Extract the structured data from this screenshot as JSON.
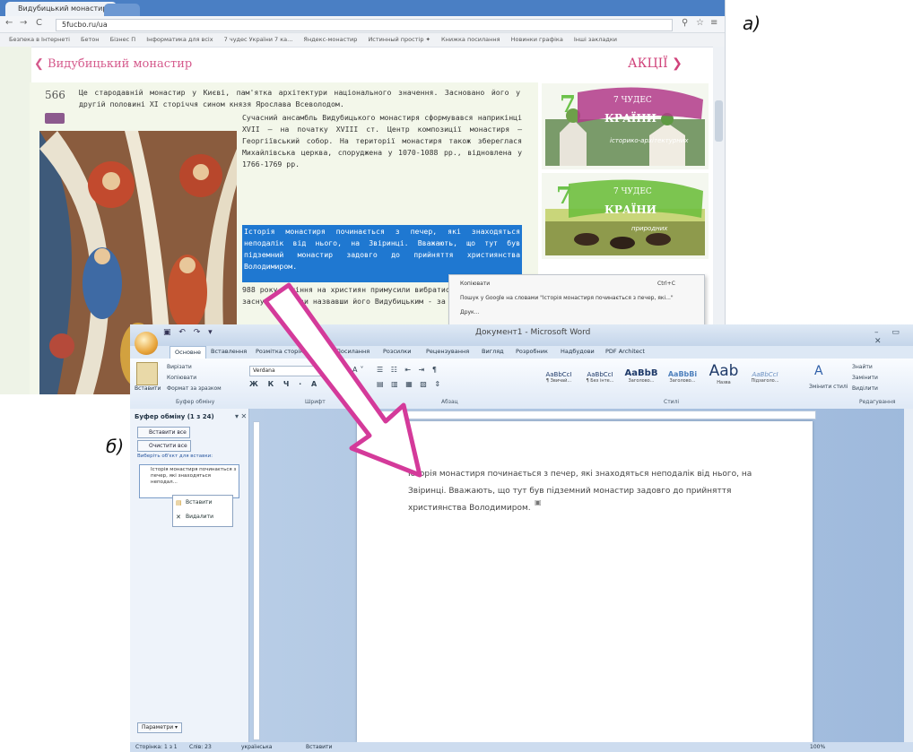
{
  "labels": {
    "a": "а)",
    "b": "б)"
  },
  "browser": {
    "tab_title": "Видубицький монастир",
    "url": "5fucbo.ru/ua",
    "window_controls": "— ▭ ✕",
    "bookmarks": [
      "Безпека в Інтернеті",
      "Бетон",
      "Бізнес П",
      "Інформатика для всіх",
      "7 чудес України 7 ка...",
      "Яндекс-монастир",
      "Истинный простір ✦",
      "Книжка посилання",
      "Новинки графіка",
      "Інші закладки"
    ],
    "site_title": "Видубицький монастир",
    "promo_label": "АКЦІЇ",
    "page_number": "566",
    "article_intro": "Це стародавній монастир у Києві, пам'ятка архітектури національного значення. Засновано його у другій половині XI сторіччя сином князя Ярослава Всеволодом.",
    "article_p1": "Сучасний ансамбль Видубицького монастиря сформувався наприкінці XVII – на початку XVIII ст. Центр композиції монастиря — Георгіївський собор. На території монастиря також збереглася Михайлівська церква, споруджена у 1070-1088 рр., відновлена у 1766-1769 рр.",
    "article_selected": "Історія монастиря починається з печер, які знаходяться неподалік від нього, на Звіринці. Вважають, що тут був підземний монастир задовго до прийняття християнства Володимиром.",
    "article_after": "988 року гоніння на християн примусили вибратися з підлля, заснувавши нови назвавши його Видубицьким - за назво",
    "context_menu": {
      "copy": "Копіювати",
      "copy_shortcut": "Ctrl+C",
      "search": "Пошук у Google на словами \"Історія монастиря починається з печер, які...\"",
      "more": "Друк..."
    },
    "ads": [
      {
        "line1": "7 ЧУДЕС",
        "line2": "КРАЇНИ",
        "line3": "історико-архітектурних"
      },
      {
        "line1": "7 ЧУДЕС",
        "line2": "КРАЇНИ",
        "line3": "природних"
      }
    ]
  },
  "word": {
    "window_title": "Документ1 - Microsoft Word",
    "tabs": [
      "Основне",
      "Вставлення",
      "Розмітка сторінки",
      "Посилання",
      "Розсилки",
      "Рецензування",
      "Вигляд",
      "Розробник",
      "Надбудови",
      "PDF Architect"
    ],
    "active_tab": "Основне",
    "clipboard_group": {
      "paste": "Вставити",
      "cut": "Вирізати",
      "copy": "Копіювати",
      "format_painter": "Формат за зразком",
      "label": "Буфер обміну"
    },
    "font_group": {
      "font_name": "Verdana",
      "label": "Шрифт"
    },
    "paragraph_label": "Абзац",
    "styles_label": "Стилі",
    "editing_label": "Редагування",
    "styles": [
      {
        "preview": "AaBbCcI",
        "name": "¶ Звичай..."
      },
      {
        "preview": "AaBbCcI",
        "name": "¶ Без інте..."
      },
      {
        "preview": "AaBbB",
        "name": "Заголово..."
      },
      {
        "preview": "AaBbBi",
        "name": "Заголово..."
      },
      {
        "preview": "Aab",
        "name": "Назва"
      },
      {
        "preview": "AaBbCcI",
        "name": "Підзаголо..."
      }
    ],
    "change_styles": "Змінити стилі",
    "editing": [
      "Знайти",
      "Замінити",
      "Виділити"
    ],
    "clip_pane": {
      "title": "Буфер обміну (1 з 24)",
      "paste_all": "Вставити все",
      "clear_all": "Очистити все",
      "hint": "Виберіть об'єкт для вставки:",
      "item_text": "Історія монастиря починається з печер, які знаходяться неподал...",
      "menu_paste": "Вставити",
      "menu_delete": "Видалити",
      "options": "Параметри"
    },
    "document_text": "Історія монастиря починається з печер, які знаходяться неподалік від нього, на Звіринці. Вважають, що тут був підземний монастир задовго до прийняття християнства Володимиром.",
    "status": {
      "page": "Сторінка: 1 з 1",
      "words": "Слів: 23",
      "language": "українська",
      "mode": "Вставити",
      "zoom": "100%"
    }
  },
  "colors": {
    "accent_pink": "#d0427a",
    "selection_blue": "#1f78d1",
    "arrow_magenta": "#d43a9a"
  }
}
